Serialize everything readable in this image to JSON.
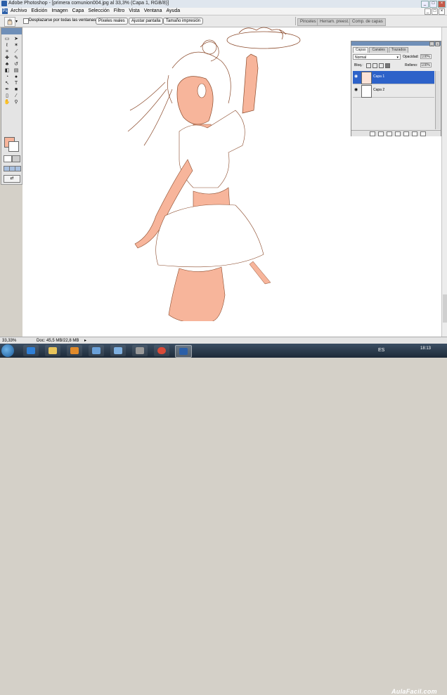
{
  "window": {
    "title": "Adobe Photoshop - [primera comunion004.jpg al 33,3% (Capa 1, RGB/8)]"
  },
  "menu": [
    "Archivo",
    "Edición",
    "Imagen",
    "Capa",
    "Selección",
    "Filtro",
    "Vista",
    "Ventana",
    "Ayuda"
  ],
  "options": {
    "scroll_all_windows": "Desplazarse por todas las ventanas",
    "btn_actual": "Píxeles reales",
    "btn_fit": "Ajustar pantalla",
    "btn_print": "Tamaño impresión"
  },
  "palette_well": [
    "Pinceles",
    "Herram. preest.",
    "Comp. de capas"
  ],
  "layers_panel": {
    "tabs": [
      "Capas",
      "Canales",
      "Trazados"
    ],
    "blend_mode": "Normal",
    "opacity_label": "Opacidad:",
    "opacity_value": "100%",
    "lock_label": "Bloq.:",
    "fill_label": "Relleno:",
    "fill_value": "100%",
    "layers": [
      {
        "name": "Capa 1",
        "selected": true
      },
      {
        "name": "Capa 2",
        "selected": false
      }
    ]
  },
  "status": {
    "zoom": "33,33%",
    "doc": "Doc: 45,5 MB/22,8 MB"
  },
  "taskbar": {
    "lang": "ES",
    "time": "18:13"
  },
  "watermark": "AulaFacil.com",
  "colors": {
    "foreground": "#f7b59b",
    "background": "#ffffff",
    "skin": "#f7b59b",
    "line": "#8b4a2b"
  }
}
